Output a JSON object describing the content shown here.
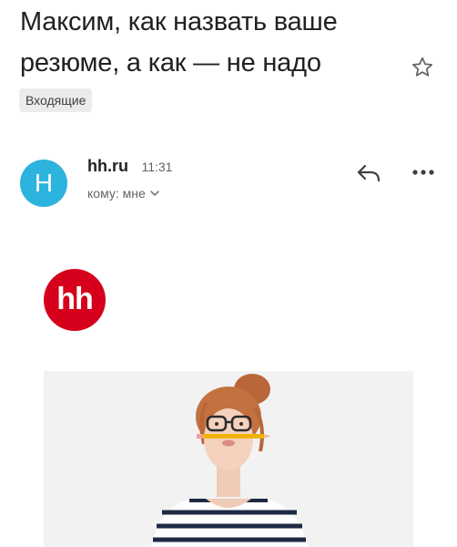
{
  "email": {
    "subject_line1": "Максим, как назвать ваше",
    "subject_line2": "резюме, а как — не надо",
    "label": "Входящие",
    "sender": {
      "avatar_letter": "H",
      "avatar_color": "#2cb3de",
      "name": "hh.ru",
      "time": "11:31",
      "recipient": "кому: мне"
    },
    "body": {
      "logo_text": "hh",
      "logo_color": "#d6001c"
    }
  },
  "icons": {
    "star": "star-icon",
    "reply": "reply-icon",
    "more": "more-horizontal-icon",
    "expand": "chevron-down-icon"
  }
}
